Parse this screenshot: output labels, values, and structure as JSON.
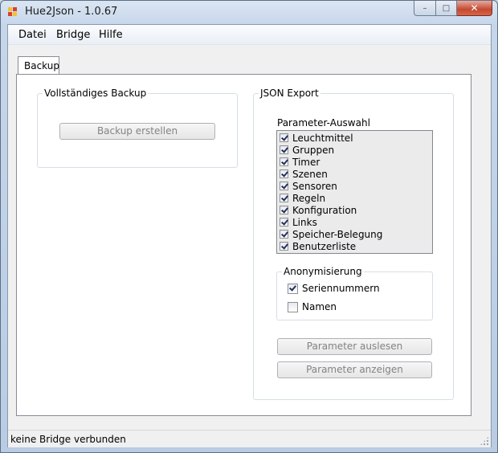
{
  "window": {
    "title": "Hue2Json - 1.0.67",
    "minimize": "–",
    "maximize": "□",
    "close": "✕"
  },
  "menu": {
    "items": [
      "Datei",
      "Bridge",
      "Hilfe"
    ]
  },
  "tabs": {
    "backup_label": "Backup"
  },
  "backup_group": {
    "title": "Vollständiges Backup",
    "button": "Backup erstellen"
  },
  "json_export": {
    "title": "JSON Export",
    "param_label": "Parameter-Auswahl",
    "params": [
      {
        "label": "Leuchtmittel",
        "checked": true
      },
      {
        "label": "Gruppen",
        "checked": true
      },
      {
        "label": "Timer",
        "checked": true
      },
      {
        "label": "Szenen",
        "checked": true
      },
      {
        "label": "Sensoren",
        "checked": true
      },
      {
        "label": "Regeln",
        "checked": true
      },
      {
        "label": "Konfiguration",
        "checked": true
      },
      {
        "label": "Links",
        "checked": true
      },
      {
        "label": "Speicher-Belegung",
        "checked": true
      },
      {
        "label": "Benutzerliste",
        "checked": true
      }
    ],
    "anon_title": "Anonymisierung",
    "anon_serial": {
      "label": "Seriennummern",
      "checked": true
    },
    "anon_names": {
      "label": "Namen",
      "checked": false
    },
    "read_button": "Parameter auslesen",
    "show_button": "Parameter anzeigen"
  },
  "status": {
    "text": "keine Bridge verbunden"
  }
}
